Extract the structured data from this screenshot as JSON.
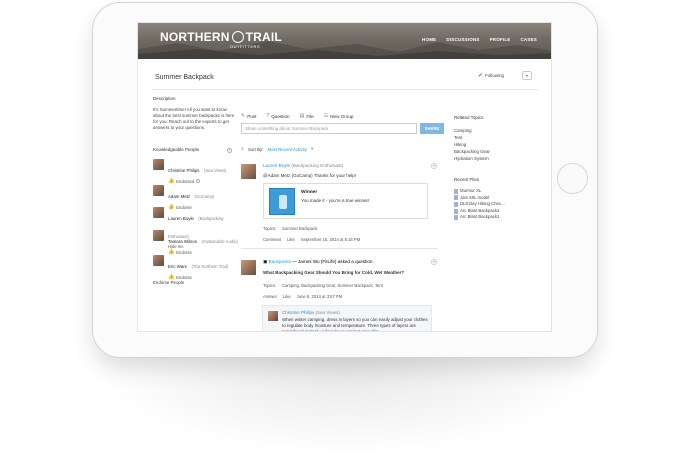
{
  "brand": {
    "name_left": "NORTHERN",
    "name_right": "TRAIL",
    "sub": "OUTFITTERS"
  },
  "nav": [
    "HOME",
    "DISCUSSIONS",
    "PROFILE",
    "CASES"
  ],
  "page": {
    "title": "Summer Backpack",
    "follow_label": "Following"
  },
  "description": {
    "label": "Description",
    "text": "It's Summertime! All you want to know about the best summer backpacks is here for you. Reach out to the experts to get answers to your questions."
  },
  "knowledgeable": {
    "label": "Knowledgeable People",
    "people": [
      {
        "name": "Christine Philips",
        "role": "(Sea Views)",
        "action": "Endorsed"
      },
      {
        "name": "Adam Metz",
        "role": "(GoCamp)",
        "action": "Endorse"
      },
      {
        "name": "Lauren Boyle",
        "role": "(Backpacking Enthusiast)",
        "action": "Hide me"
      },
      {
        "name": "Tamara Wilson",
        "role": "(Sustainable Audio)",
        "action": "Endorse"
      },
      {
        "name": "Eric Ware",
        "role": "(The Northern Trail)",
        "action": "Endorse"
      }
    ],
    "footer": "Endorse People"
  },
  "publisher": {
    "actions": [
      "Post",
      "Question",
      "File",
      "New Group"
    ],
    "placeholder": "Share something about Summer Backpack",
    "share_label": "SHARE"
  },
  "sort": {
    "label": "Sort By:",
    "value": "Most Recent Activity"
  },
  "feed": {
    "post1": {
      "author": "Lauren Boyle",
      "role": "(Backpacking Enthusiast)",
      "text": "@Adam Metz (GoCamp) Thanks for your help!",
      "card_title": "Winner",
      "card_text": "You made it - you're a true winner!",
      "topics_label": "Topics:",
      "topics": "Summer Backpack",
      "meta": [
        "Comment",
        "Like",
        "September 15, 2014 at 5:15 PM"
      ]
    },
    "post2": {
      "header": "Backpacks",
      "header_rest": "— James Wu (FitLife) asked a question.",
      "question": "What Backpacking Gear Should You Bring for Cold, Wet Weather?",
      "topics_label": "Topics:",
      "topics": "Camping, Backpacking Gear, Summer Backpack, Tent",
      "meta": [
        "Answer",
        "Like",
        "June 8, 2014 at 3:57 PM"
      ]
    },
    "reply": {
      "author": "Christine Philips",
      "role": "(Sea Views)",
      "text": "When winter camping, dress in layers so you can easily adjust your clothes to regulate body moisture and temperature. Three types of layers are considered normal : a liner layer against your skin"
    }
  },
  "related_topics": {
    "label": "Related Topics",
    "items": [
      "Camping",
      "Tent",
      "Hiking",
      "Backpacking Gear",
      "Hydration System"
    ]
  },
  "recent_files": {
    "label": "Recent Files",
    "items": [
      "Murmur XL",
      "Jam 50L model",
      "DL8 Day Hiking Chec...",
      "Arc Blast Backpack2",
      "Arc Blast Backpack1"
    ]
  }
}
